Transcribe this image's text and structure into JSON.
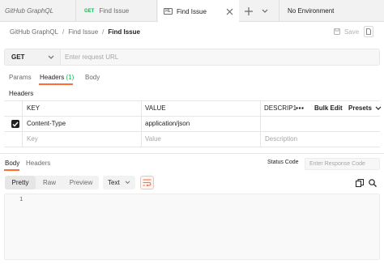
{
  "tabs": [
    {
      "label": "GitHub GraphQL",
      "kind": "collection"
    },
    {
      "method": "GET",
      "label": "Find Issue"
    },
    {
      "label": "Find Issue",
      "kind": "active"
    }
  ],
  "environment": {
    "label": "No Environment"
  },
  "breadcrumb": {
    "parts": [
      "GitHub GraphQL",
      "Find Issue",
      "Find Issue"
    ]
  },
  "toolbar": {
    "save_label": "Save"
  },
  "request": {
    "method": "GET",
    "url_placeholder": "Enter request URL",
    "tabs": [
      {
        "label": "Params"
      },
      {
        "label": "Headers",
        "count": "(1)"
      },
      {
        "label": "Body"
      }
    ],
    "section_label": "Headers",
    "table": {
      "columns": {
        "key": "KEY",
        "value": "VALUE",
        "description": "DESCRIP1",
        "bulk_edit": "Bulk Edit",
        "presets": "Presets"
      },
      "rows": [
        {
          "checked": true,
          "key": "Content-Type",
          "value": "application/json"
        }
      ],
      "placeholders": {
        "key": "Key",
        "value": "Value",
        "description": "Description"
      }
    }
  },
  "response": {
    "tabs": [
      {
        "label": "Body"
      },
      {
        "label": "Headers"
      }
    ],
    "status_code_label": "Status Code",
    "response_code_placeholder": "Enter Response Code",
    "views": [
      "Pretty",
      "Raw",
      "Preview"
    ],
    "format": "Text",
    "editor": {
      "line_numbers": [
        "1"
      ]
    }
  },
  "colors": {
    "accent": "#ff6c37",
    "get_method": "#0cbb52"
  }
}
